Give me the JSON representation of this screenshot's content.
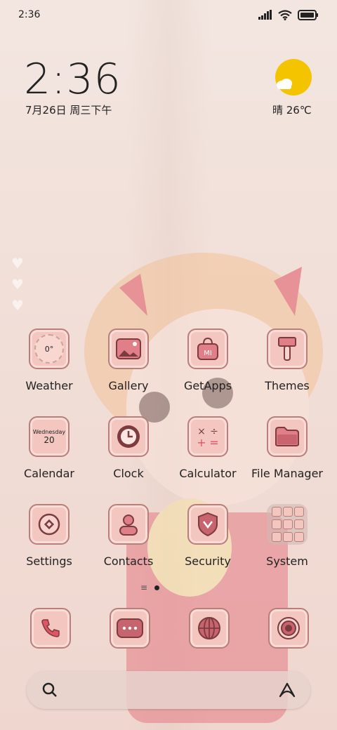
{
  "status_bar": {
    "time": "2:36"
  },
  "clock_widget": {
    "time": "2:36",
    "date": "7月26日 周三下午"
  },
  "weather_widget": {
    "text": "晴 26℃"
  },
  "icon_texts": {
    "weather": "0°",
    "calendar_day_name": "Wednesday",
    "calendar_day": "20"
  },
  "apps": [
    {
      "label": "Weather",
      "icon": "weather-icon"
    },
    {
      "label": "Gallery",
      "icon": "gallery-icon"
    },
    {
      "label": "GetApps",
      "icon": "getapps-icon"
    },
    {
      "label": "Themes",
      "icon": "themes-icon"
    },
    {
      "label": "Calendar",
      "icon": "calendar-icon"
    },
    {
      "label": "Clock",
      "icon": "clock-icon"
    },
    {
      "label": "Calculator",
      "icon": "calculator-icon"
    },
    {
      "label": "File Manager",
      "icon": "file-manager-icon"
    },
    {
      "label": "Settings",
      "icon": "settings-icon"
    },
    {
      "label": "Contacts",
      "icon": "contacts-icon"
    },
    {
      "label": "Security",
      "icon": "security-icon"
    },
    {
      "label": "System",
      "icon": "system-folder-icon"
    }
  ],
  "dock": [
    "phone-icon",
    "messages-icon",
    "browser-icon",
    "camera-icon"
  ],
  "colors": {
    "icon_fill": "#f4c6c0",
    "icon_border": "#b87f7a",
    "sun": "#f5c400"
  }
}
